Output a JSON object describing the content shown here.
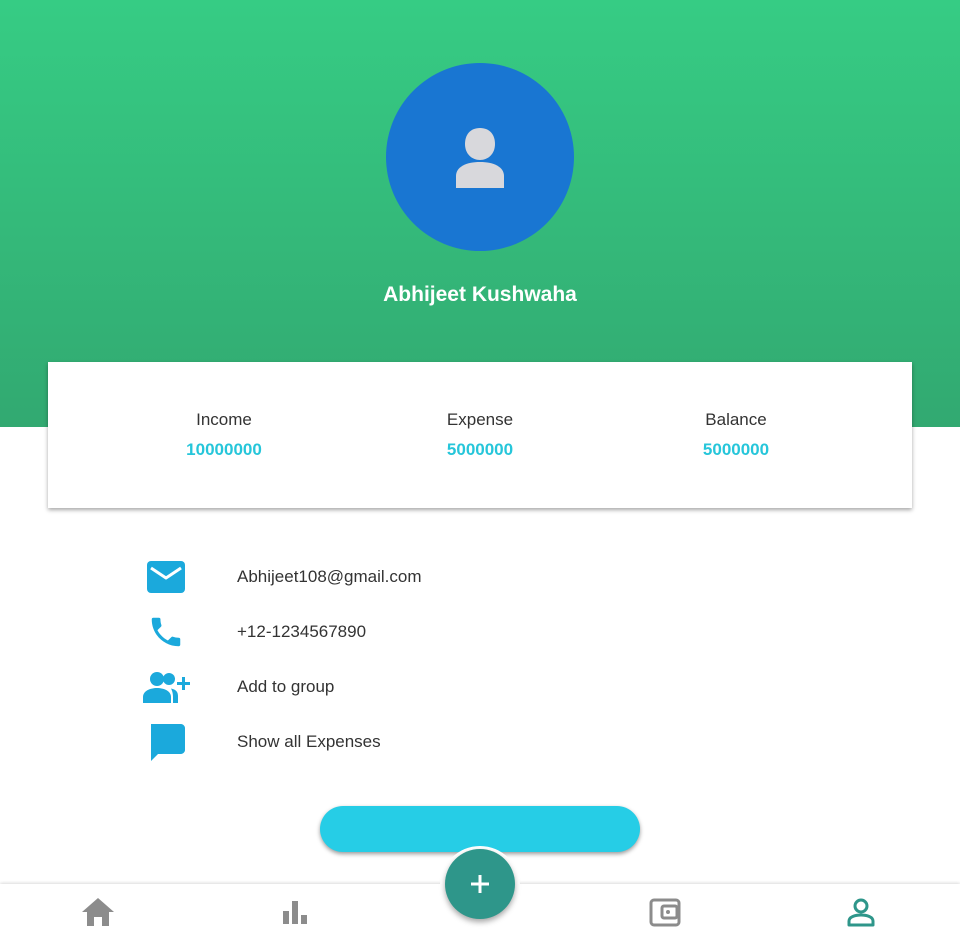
{
  "profile": {
    "name": "Abhijeet Kushwaha",
    "avatar_icon": "person-icon"
  },
  "summary": {
    "income": {
      "label": "Income",
      "value": "10000000"
    },
    "expense": {
      "label": "Expense",
      "value": "5000000"
    },
    "balance": {
      "label": "Balance",
      "value": "5000000"
    }
  },
  "details": {
    "email": "Abhijeet108@gmail.com",
    "phone": "+12-1234567890",
    "add_group": "Add to group",
    "show_expenses": "Show all Expenses"
  },
  "action_button": {
    "label": ""
  },
  "bottom_nav": {
    "items": [
      {
        "icon": "home-icon"
      },
      {
        "icon": "bar-chart-icon"
      },
      {
        "icon": "wallet-icon"
      },
      {
        "icon": "profile-icon",
        "active": true
      }
    ],
    "fab_icon": "plus-icon"
  },
  "colors": {
    "header_top": "#36cc84",
    "header_bottom": "#32a971",
    "avatar_bg": "#1976d2",
    "accent": "#26c6da",
    "fab": "#2e968a",
    "nav_active": "#2e968a",
    "nav_inactive": "#8c8c8c"
  }
}
